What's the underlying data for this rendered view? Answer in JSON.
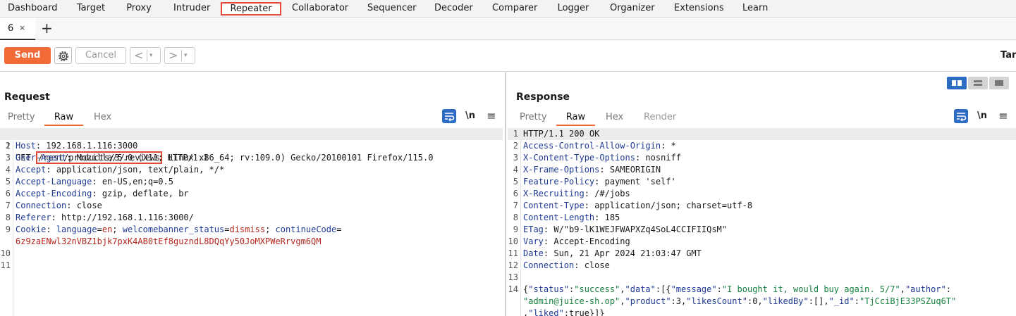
{
  "nav": {
    "tabs": [
      "Dashboard",
      "Target",
      "Proxy",
      "Intruder",
      "Repeater",
      "Collaborator",
      "Sequencer",
      "Decoder",
      "Comparer",
      "Logger",
      "Organizer",
      "Extensions",
      "Learn"
    ],
    "active": "Repeater"
  },
  "repeater_tab": {
    "label": "6",
    "close": "×",
    "add": "+"
  },
  "toolbar": {
    "send": "Send",
    "cancel": "Cancel",
    "back": "<",
    "forward": ">",
    "dropdown": "▾",
    "target": "Tar"
  },
  "request": {
    "title": "Request",
    "views": [
      "Pretty",
      "Raw",
      "Hex"
    ],
    "active_view": "Raw",
    "icons": {
      "wrap": "\\n",
      "menu": "≡"
    },
    "lines": [
      {
        "n": "1",
        "method": "GET",
        "path": "/rest/products/3/reviews",
        "proto": "HTTP/1.1"
      },
      {
        "n": "2",
        "key": "Host",
        "value": "192.168.1.116:3000"
      },
      {
        "n": "3",
        "key": "User-Agent",
        "value": "Mozilla/5.0 (X11; Linux x86_64; rv:109.0) Gecko/20100101 Firefox/115.0"
      },
      {
        "n": "4",
        "key": "Accept",
        "value": "application/json, text/plain, */*"
      },
      {
        "n": "5",
        "key": "Accept-Language",
        "value": "en-US,en;q=0.5"
      },
      {
        "n": "6",
        "key": "Accept-Encoding",
        "value": "gzip, deflate, br"
      },
      {
        "n": "7",
        "key": "Connection",
        "value": "close"
      },
      {
        "n": "8",
        "key": "Referer",
        "value": "http://192.168.1.116:3000/"
      },
      {
        "n": "9",
        "key": "Cookie",
        "c1k": "language",
        "c1v": "en",
        "c2k": "welcomebanner_status",
        "c2v": "dismiss",
        "c3k": "continueCode",
        "c3v": "6z9zaENwl32nVBZ1bjk7pxK4AB0tEf8guzndL8DQqYy50JoMXPWeRrvgm6QM"
      },
      {
        "n": "10"
      },
      {
        "n": "11"
      }
    ]
  },
  "response": {
    "title": "Response",
    "views": [
      "Pretty",
      "Raw",
      "Hex",
      "Render"
    ],
    "active_view": "Raw",
    "icons": {
      "wrap": "\\n",
      "menu": "≡"
    },
    "lines": [
      {
        "n": "1",
        "status": "HTTP/1.1 200 OK"
      },
      {
        "n": "2",
        "key": "Access-Control-Allow-Origin",
        "value": "*"
      },
      {
        "n": "3",
        "key": "X-Content-Type-Options",
        "value": "nosniff"
      },
      {
        "n": "4",
        "key": "X-Frame-Options",
        "value": "SAMEORIGIN"
      },
      {
        "n": "5",
        "key": "Feature-Policy",
        "value": "payment 'self'"
      },
      {
        "n": "6",
        "key": "X-Recruiting",
        "value": "/#/jobs"
      },
      {
        "n": "7",
        "key": "Content-Type",
        "value": "application/json; charset=utf-8"
      },
      {
        "n": "8",
        "key": "Content-Length",
        "value": "185"
      },
      {
        "n": "9",
        "key": "ETag",
        "value": "W/\"b9-lK1WEJFWAPXZq4SoL4CCIFIIQsM\""
      },
      {
        "n": "10",
        "key": "Vary",
        "value": "Accept-Encoding"
      },
      {
        "n": "11",
        "key": "Date",
        "value": "Sun, 21 Apr 2024 21:03:47 GMT"
      },
      {
        "n": "12",
        "key": "Connection",
        "value": "close"
      },
      {
        "n": "13"
      },
      {
        "n": "14"
      }
    ],
    "json": {
      "k_status": "\"status\"",
      "v_status": "\"success\"",
      "k_data": "\"data\"",
      "k_message": "\"message\"",
      "v_message": "\"I bought it, would buy again. 5/7\"",
      "k_author": "\"author\"",
      "v_author": "\"admin@juice-sh.op\"",
      "k_product": "\"product\"",
      "v_product": "3",
      "k_likes": "\"likesCount\"",
      "v_likes": "0",
      "k_likedby": "\"likedBy\"",
      "v_likedby": "[]",
      "k_id": "\"_id\"",
      "v_id": "\"TjCciBjE33PSZuq6T\"",
      "k_liked": "\"liked\"",
      "v_liked": "true"
    }
  }
}
